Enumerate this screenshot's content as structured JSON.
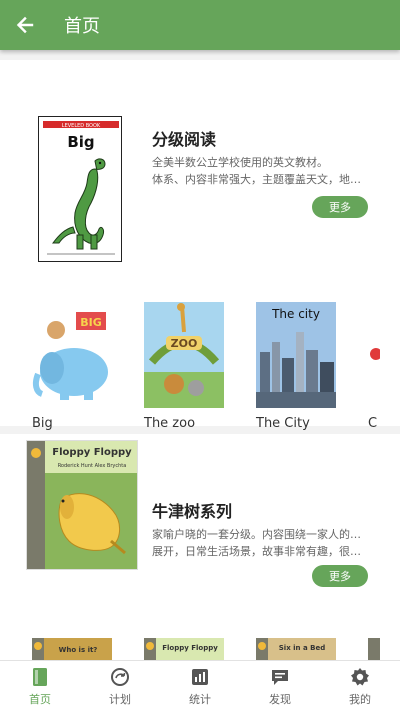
{
  "appbar": {
    "title": "首页",
    "back_icon": "arrow-left-icon"
  },
  "sections": [
    {
      "title": "分级阅读",
      "desc_line1": "全美半数公立学校使用的英文教材。",
      "desc_line2": "体系、内容非常强大，主题覆盖天文，地理…",
      "more_label": "更多",
      "cover_text": {
        "header": "LEVELED BOOK",
        "title": "Big"
      },
      "books": [
        {
          "label": "Big",
          "cover_text": "BIG"
        },
        {
          "label": "The zoo",
          "cover_text": "ZOO"
        },
        {
          "label": "The City",
          "cover_text": "The city"
        },
        {
          "label": "C"
        }
      ]
    },
    {
      "title": "牛津树系列",
      "desc_line1": "家喻户晓的一套分级。内容围绕一家人的生活",
      "desc_line2": "展开，日常生活场景，故事非常有趣，很吸…",
      "more_label": "更多",
      "cover_text": {
        "title": "Floppy Floppy",
        "authors": "Roderick Hunt     Alex Brychta"
      },
      "books": [
        {
          "cover_text": "Who is it?"
        },
        {
          "cover_text": "Floppy Floppy"
        },
        {
          "cover_text": "Six in a Bed"
        }
      ]
    }
  ],
  "tabs": [
    {
      "label": "首页",
      "icon": "book-icon",
      "active": true
    },
    {
      "label": "计划",
      "icon": "refresh-icon"
    },
    {
      "label": "统计",
      "icon": "chart-icon"
    },
    {
      "label": "发现",
      "icon": "message-icon"
    },
    {
      "label": "我的",
      "icon": "gear-icon"
    }
  ],
  "colors": {
    "primary": "#66a55a",
    "background": "#f2f2f2"
  }
}
